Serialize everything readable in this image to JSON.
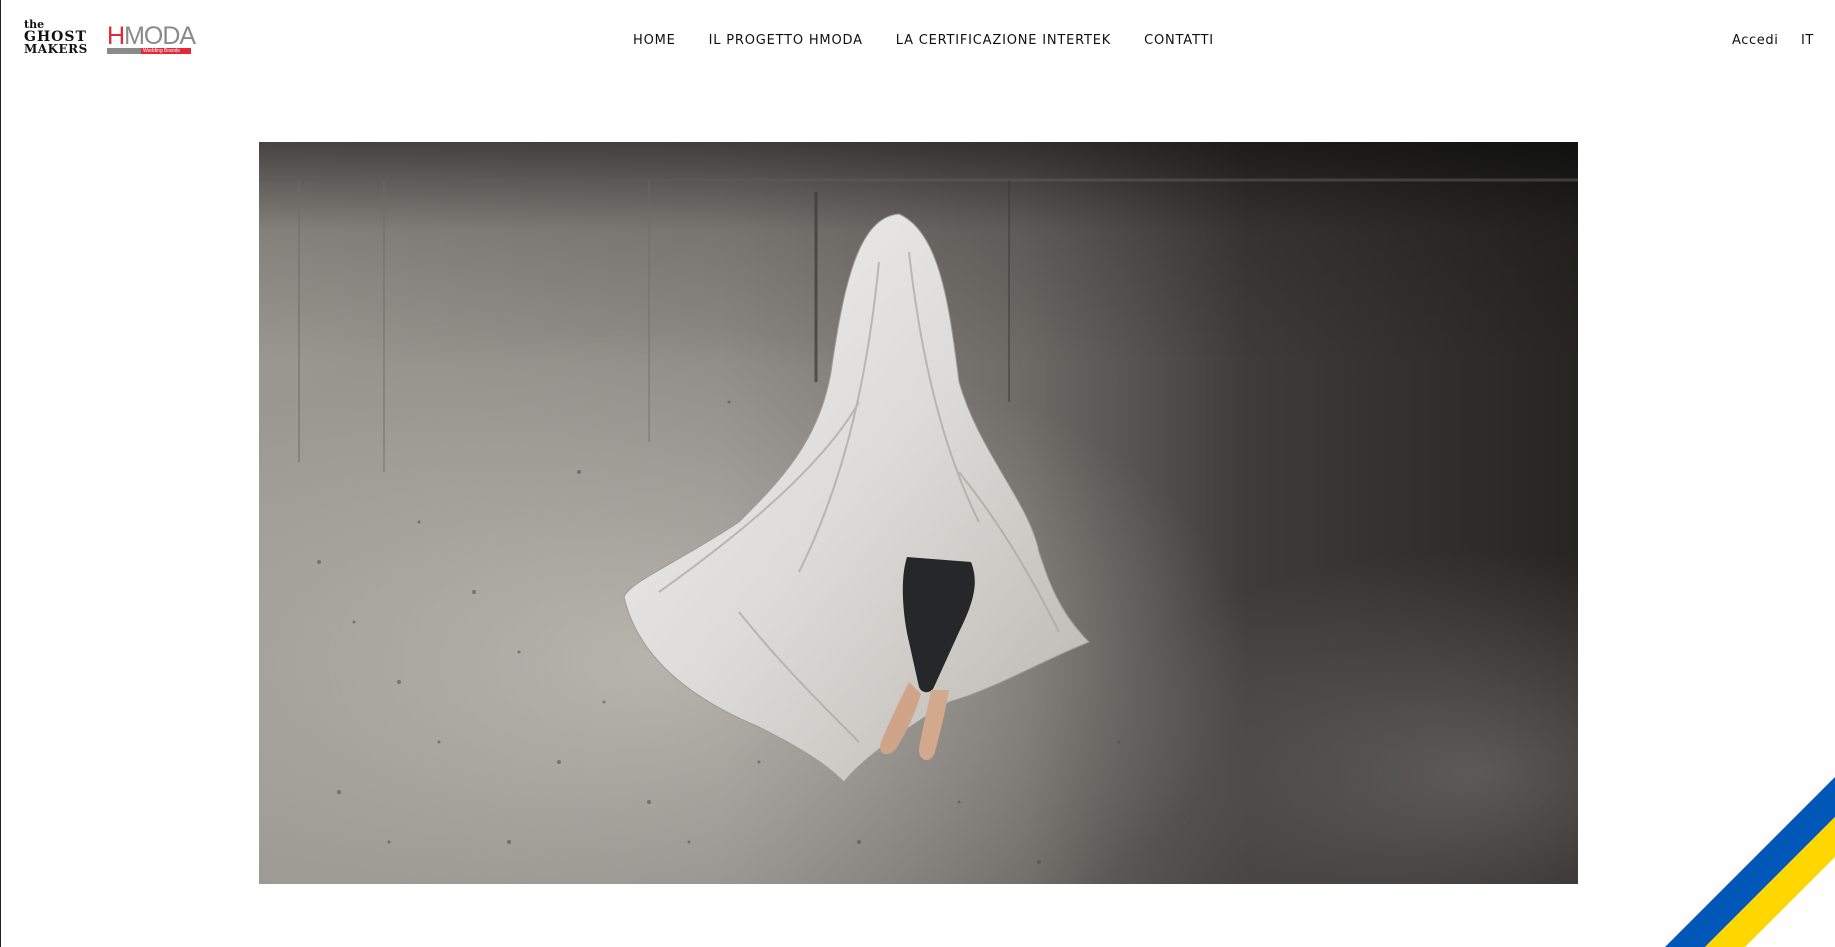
{
  "brand": {
    "ghost_logo": [
      "the",
      "GHOST",
      "MAKERS"
    ],
    "hmoda_logo": {
      "word": "MODA",
      "letter": "H",
      "sub": "Wedding Brands",
      "red": "#e3283a",
      "grey": "#8a8a8a"
    }
  },
  "nav": {
    "items": [
      {
        "label": "HOME"
      },
      {
        "label": "IL PROGETTO HMODA"
      },
      {
        "label": "LA CERTIFICAZIONE INTERTEK"
      },
      {
        "label": "CONTATTI"
      }
    ]
  },
  "header_right": {
    "login_label": "Accedi",
    "language": "IT"
  },
  "hero": {
    "image_subject": "ghost-sheet-photo"
  },
  "ribbon": {
    "colors": [
      "#0057b7",
      "#ffd700"
    ]
  }
}
